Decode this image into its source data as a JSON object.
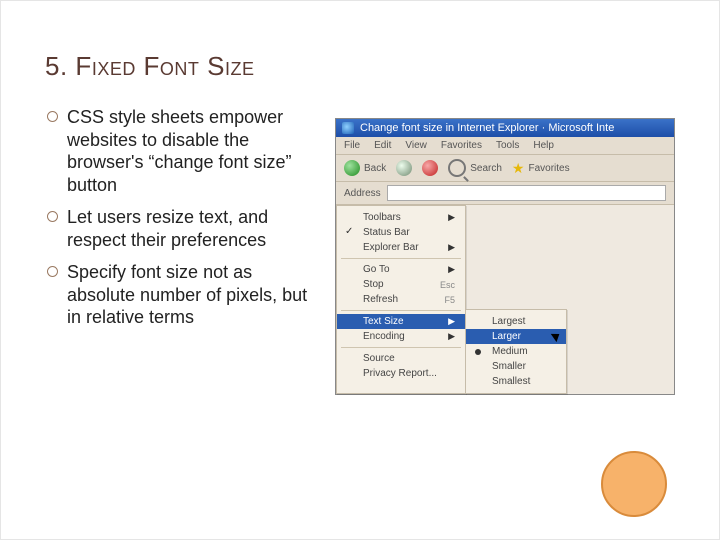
{
  "title_number": "5.",
  "title_first": "F",
  "title_rest": "ixed Font Size",
  "bullets": [
    "CSS style sheets empower websites to disable the browser's “change font size” button",
    "Let users resize text, and respect their preferences",
    "Specify font size not as absolute number of pixels, but in relative terms"
  ],
  "shot": {
    "window_title": "Change font size in Internet Explorer · Microsoft Inte",
    "menubar": [
      "File",
      "Edit",
      "View",
      "Favorites",
      "Tools",
      "Help"
    ],
    "toolbar": {
      "back": "Back",
      "search": "Search",
      "favorites": "Favorites"
    },
    "address_label": "Address",
    "view_menu": {
      "toolbars": "Toolbars",
      "status_bar": "Status Bar",
      "explorer_bar": "Explorer Bar",
      "go_to": "Go To",
      "stop": "Stop",
      "stop_sc": "Esc",
      "refresh": "Refresh",
      "refresh_sc": "F5",
      "text_size": "Text Size",
      "encoding": "Encoding",
      "source": "Source",
      "privacy": "Privacy Report..."
    },
    "text_size_menu": {
      "largest": "Largest",
      "larger": "Larger",
      "medium": "Medium",
      "smaller": "Smaller",
      "smallest": "Smallest"
    }
  }
}
